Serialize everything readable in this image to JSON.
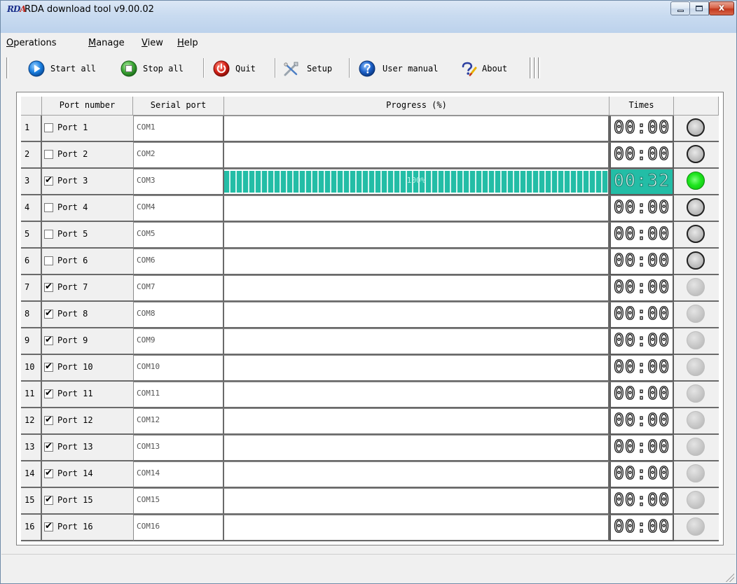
{
  "window": {
    "title": "RDA download tool v9.00.02",
    "icon_text": "RDA",
    "close_glyph": "x"
  },
  "menu": [
    {
      "underlined": "O",
      "rest": "perations"
    },
    {
      "underlined": "M",
      "rest": "anage"
    },
    {
      "underlined": "V",
      "rest": "iew"
    },
    {
      "underlined": "H",
      "rest": "elp"
    }
  ],
  "toolbar": {
    "start_all": "Start all",
    "stop_all": "Stop all",
    "quit": "Quit",
    "setup": "Setup",
    "user_manual": "User manual",
    "about": "About",
    "icons": {
      "start_all": "play-icon",
      "stop_all": "stop-icon",
      "quit": "power-icon",
      "setup": "tools-icon",
      "user_manual": "help-icon",
      "about": "about-icon"
    }
  },
  "grid": {
    "headers": {
      "port_number": "Port number",
      "serial_port": "Serial port",
      "progress": "Progress (%)",
      "times": "Times",
      "status": ""
    },
    "rows": [
      {
        "num": "1",
        "port": "Port 1",
        "checked": false,
        "serial": "COM1",
        "progress": 0,
        "progress_text": "",
        "time": "00:00",
        "status": "idle"
      },
      {
        "num": "2",
        "port": "Port 2",
        "checked": false,
        "serial": "COM2",
        "progress": 0,
        "progress_text": "",
        "time": "00:00",
        "status": "idle"
      },
      {
        "num": "3",
        "port": "Port 3",
        "checked": true,
        "serial": "COM3",
        "progress": 100,
        "progress_text": "100%",
        "time": "00:32",
        "status": "ok"
      },
      {
        "num": "4",
        "port": "Port 4",
        "checked": false,
        "serial": "COM4",
        "progress": 0,
        "progress_text": "",
        "time": "00:00",
        "status": "idle"
      },
      {
        "num": "5",
        "port": "Port 5",
        "checked": false,
        "serial": "COM5",
        "progress": 0,
        "progress_text": "",
        "time": "00:00",
        "status": "idle"
      },
      {
        "num": "6",
        "port": "Port 6",
        "checked": false,
        "serial": "COM6",
        "progress": 0,
        "progress_text": "",
        "time": "00:00",
        "status": "idle"
      },
      {
        "num": "7",
        "port": "Port 7",
        "checked": true,
        "serial": "COM7",
        "progress": 0,
        "progress_text": "",
        "time": "00:00",
        "status": "off"
      },
      {
        "num": "8",
        "port": "Port 8",
        "checked": true,
        "serial": "COM8",
        "progress": 0,
        "progress_text": "",
        "time": "00:00",
        "status": "off"
      },
      {
        "num": "9",
        "port": "Port 9",
        "checked": true,
        "serial": "COM9",
        "progress": 0,
        "progress_text": "",
        "time": "00:00",
        "status": "off"
      },
      {
        "num": "10",
        "port": "Port 10",
        "checked": true,
        "serial": "COM10",
        "progress": 0,
        "progress_text": "",
        "time": "00:00",
        "status": "off"
      },
      {
        "num": "11",
        "port": "Port 11",
        "checked": true,
        "serial": "COM11",
        "progress": 0,
        "progress_text": "",
        "time": "00:00",
        "status": "off"
      },
      {
        "num": "12",
        "port": "Port 12",
        "checked": true,
        "serial": "COM12",
        "progress": 0,
        "progress_text": "",
        "time": "00:00",
        "status": "off"
      },
      {
        "num": "13",
        "port": "Port 13",
        "checked": true,
        "serial": "COM13",
        "progress": 0,
        "progress_text": "",
        "time": "00:00",
        "status": "off"
      },
      {
        "num": "14",
        "port": "Port 14",
        "checked": true,
        "serial": "COM14",
        "progress": 0,
        "progress_text": "",
        "time": "00:00",
        "status": "off"
      },
      {
        "num": "15",
        "port": "Port 15",
        "checked": true,
        "serial": "COM15",
        "progress": 0,
        "progress_text": "",
        "time": "00:00",
        "status": "off"
      },
      {
        "num": "16",
        "port": "Port 16",
        "checked": true,
        "serial": "COM16",
        "progress": 0,
        "progress_text": "",
        "time": "00:00",
        "status": "off"
      }
    ]
  },
  "colors": {
    "progress_fill": "#23bda6",
    "led_ok": "#1ee51e",
    "titlebar": "#c9dbf0"
  }
}
